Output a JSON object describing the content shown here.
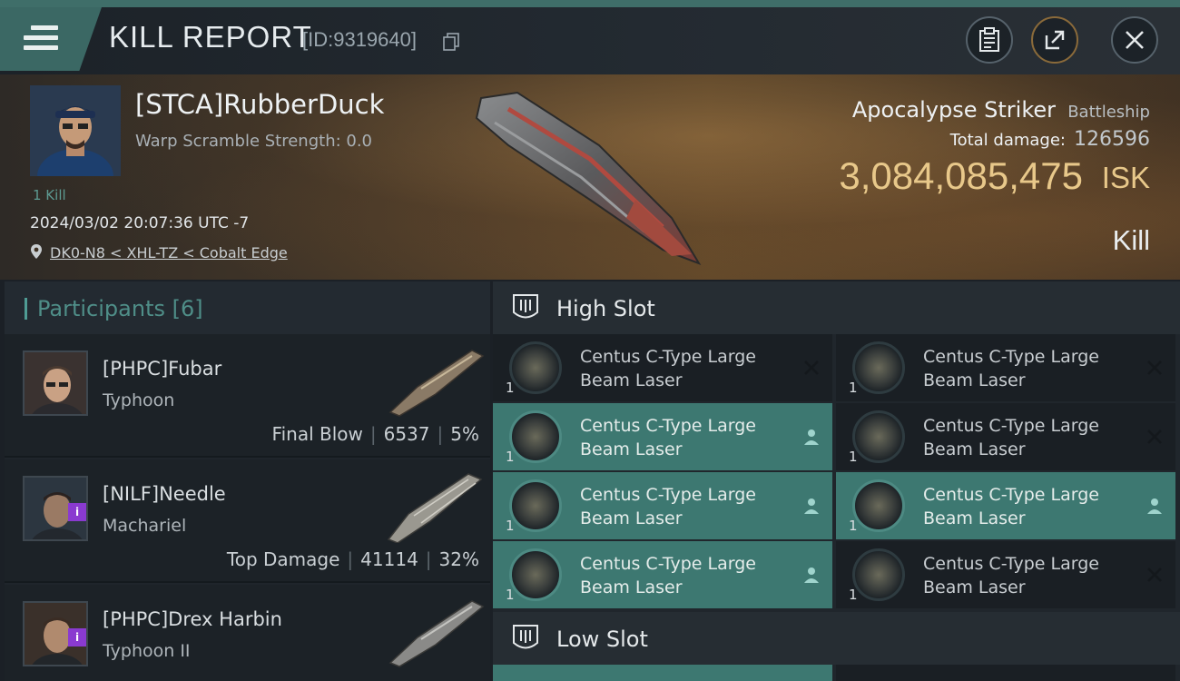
{
  "header": {
    "title": "KILL REPORT",
    "report_id": "[ID:9319640]"
  },
  "victim": {
    "name": "[STCA]RubberDuck",
    "warp_scramble": "Warp Scramble Strength: 0.0",
    "kill_count": "1 Kill",
    "datetime": "2024/03/02 20:07:36 UTC -7",
    "location": "DK0-N8 < XHL-TZ < Cobalt Edge",
    "ship_name": "Apocalypse Striker",
    "ship_class": "Battleship",
    "total_damage_label": "Total damage:",
    "total_damage": "126596",
    "isk_value": "3,084,085,475",
    "isk_label": "ISK",
    "kill_type": "Kill"
  },
  "participants": {
    "title": "Participants [6]",
    "rows": [
      {
        "name": "[PHPC]Fubar",
        "ship": "Typhoon",
        "role": "Final Blow",
        "damage": "6537",
        "percent": "5%"
      },
      {
        "name": "[NILF]Needle",
        "ship": "Machariel",
        "role": "Top Damage",
        "damage": "41114",
        "percent": "32%"
      },
      {
        "name": "[PHPC]Drex Harbin",
        "ship": "Typhoon II",
        "role": "",
        "damage": "",
        "percent": ""
      }
    ]
  },
  "slots": {
    "high_title": "High Slot",
    "low_title": "Low Slot",
    "items": [
      {
        "line1": "Centus C-Type Large",
        "line2": "Beam Laser",
        "qty": "1",
        "status": "destroyed-icon"
      },
      {
        "line1": "Centus C-Type Large",
        "line2": "Beam Laser",
        "qty": "1",
        "status": "destroyed-icon"
      },
      {
        "line1": "Centus C-Type Large",
        "line2": "Beam Laser",
        "qty": "1",
        "status": "dropped-icon"
      },
      {
        "line1": "Centus C-Type Large",
        "line2": "Beam Laser",
        "qty": "1",
        "status": "destroyed-icon"
      },
      {
        "line1": "Centus C-Type Large",
        "line2": "Beam Laser",
        "qty": "1",
        "status": "dropped-icon"
      },
      {
        "line1": "Centus C-Type Large",
        "line2": "Beam Laser",
        "qty": "1",
        "status": "dropped-icon"
      },
      {
        "line1": "Centus C-Type Large",
        "line2": "Beam Laser",
        "qty": "1",
        "status": "dropped-icon"
      },
      {
        "line1": "Centus C-Type Large",
        "line2": "Beam Laser",
        "qty": "1",
        "status": "destroyed-icon"
      }
    ]
  },
  "colors": {
    "accent": "#3d7871",
    "isk_gold": "#e8c88a",
    "badge_purple": "#8a3ad0"
  }
}
